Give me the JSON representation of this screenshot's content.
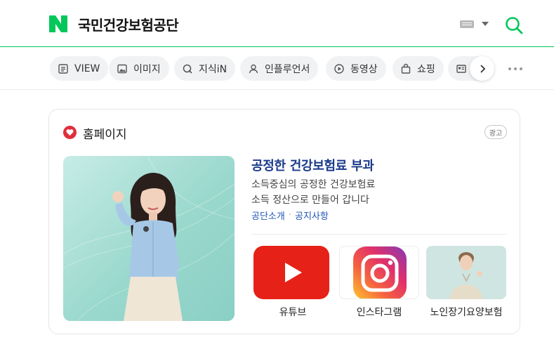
{
  "search": {
    "query": "국민건강보험공단"
  },
  "colors": {
    "brand": "#03c75a",
    "ad_title": "#1a3a8a",
    "link": "#2056b8"
  },
  "tabs": [
    {
      "label": "VIEW",
      "icon": "view-icon"
    },
    {
      "label": "이미지",
      "icon": "image-icon"
    },
    {
      "label": "지식iN",
      "icon": "kin-icon"
    },
    {
      "label": "인플루언서",
      "icon": "influencer-icon"
    },
    {
      "label": "동영상",
      "icon": "video-icon"
    },
    {
      "label": "쇼핑",
      "icon": "shopping-bag-icon"
    }
  ],
  "card": {
    "section_title": "홈페이지",
    "ad_badge": "광고",
    "title": "공정한 건강보험료 부과",
    "desc_line1": "소득중심의 공정한 건강보험료",
    "desc_line2": "소득 정산으로 만들어 갑니다",
    "links": [
      "공단소개",
      "공지사항"
    ],
    "sublinks": [
      {
        "label": "유튜브",
        "icon": "youtube-icon"
      },
      {
        "label": "인스타그램",
        "icon": "instagram-icon"
      },
      {
        "label": "노인장기요양보험",
        "icon": "person-photo"
      }
    ]
  }
}
